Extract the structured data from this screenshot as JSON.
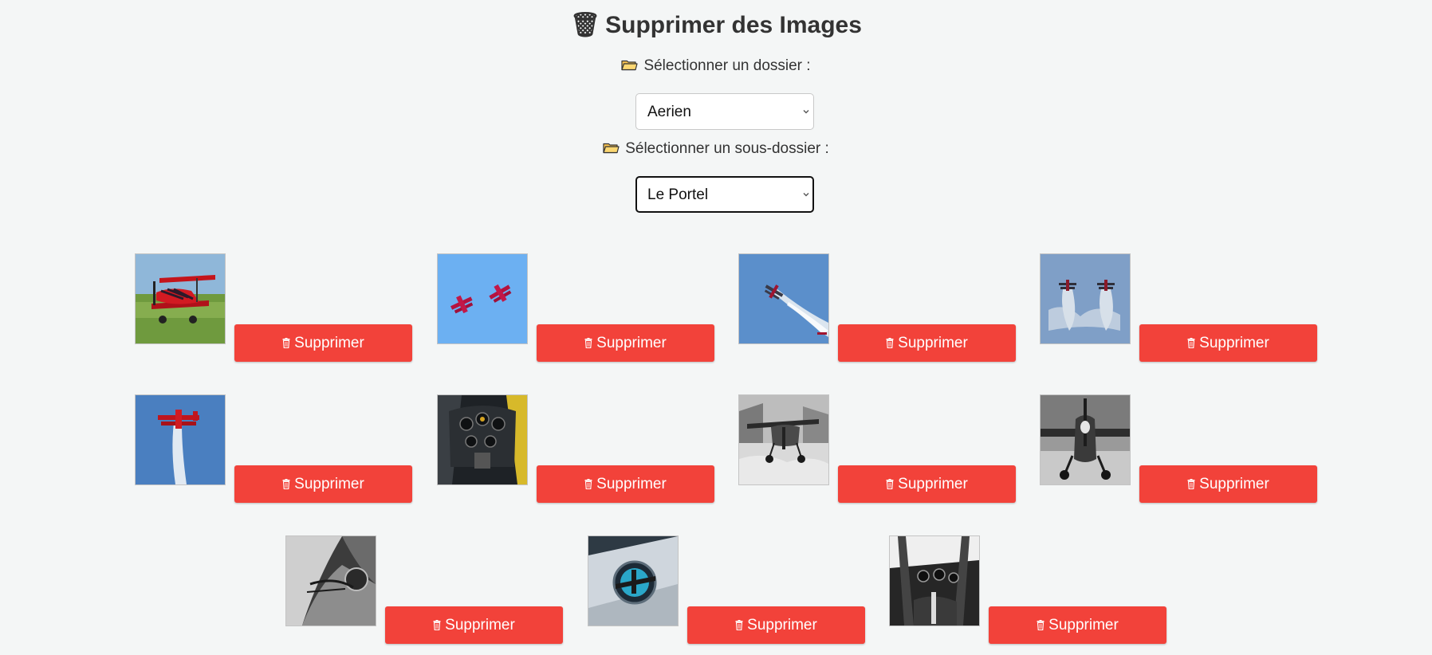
{
  "page": {
    "title_icon": "🗑",
    "title": "Supprimer des Images"
  },
  "folder_field": {
    "label": "Sélectionner un dossier :",
    "icon": "folder-icon",
    "selected": "Aerien"
  },
  "subfolder_field": {
    "label": "Sélectionner un sous-dossier :",
    "icon": "folder-icon",
    "selected": "Le Portel"
  },
  "images": [
    {
      "subject": "red-biplane-on-grass",
      "delete_label": "Supprimer"
    },
    {
      "subject": "two-biplanes-blue-sky",
      "delete_label": "Supprimer"
    },
    {
      "subject": "biplane-smoke-trail",
      "delete_label": "Supprimer"
    },
    {
      "subject": "two-biplanes-smoke",
      "delete_label": "Supprimer"
    },
    {
      "subject": "biplane-vertical-climb",
      "delete_label": "Supprimer"
    },
    {
      "subject": "cockpit-instruments-color",
      "delete_label": "Supprimer"
    },
    {
      "subject": "light-aircraft-bw",
      "delete_label": "Supprimer"
    },
    {
      "subject": "propeller-front-bw",
      "delete_label": "Supprimer"
    },
    {
      "subject": "fuselage-closeup-bw",
      "delete_label": "Supprimer"
    },
    {
      "subject": "aircraft-emblem",
      "delete_label": "Supprimer"
    },
    {
      "subject": "cockpit-interior-bw",
      "delete_label": "Supprimer"
    }
  ],
  "colors": {
    "background": "#f4f6f6",
    "delete_button": "#f2423a",
    "text": "#333333",
    "folder_icon": "#f5c150"
  }
}
